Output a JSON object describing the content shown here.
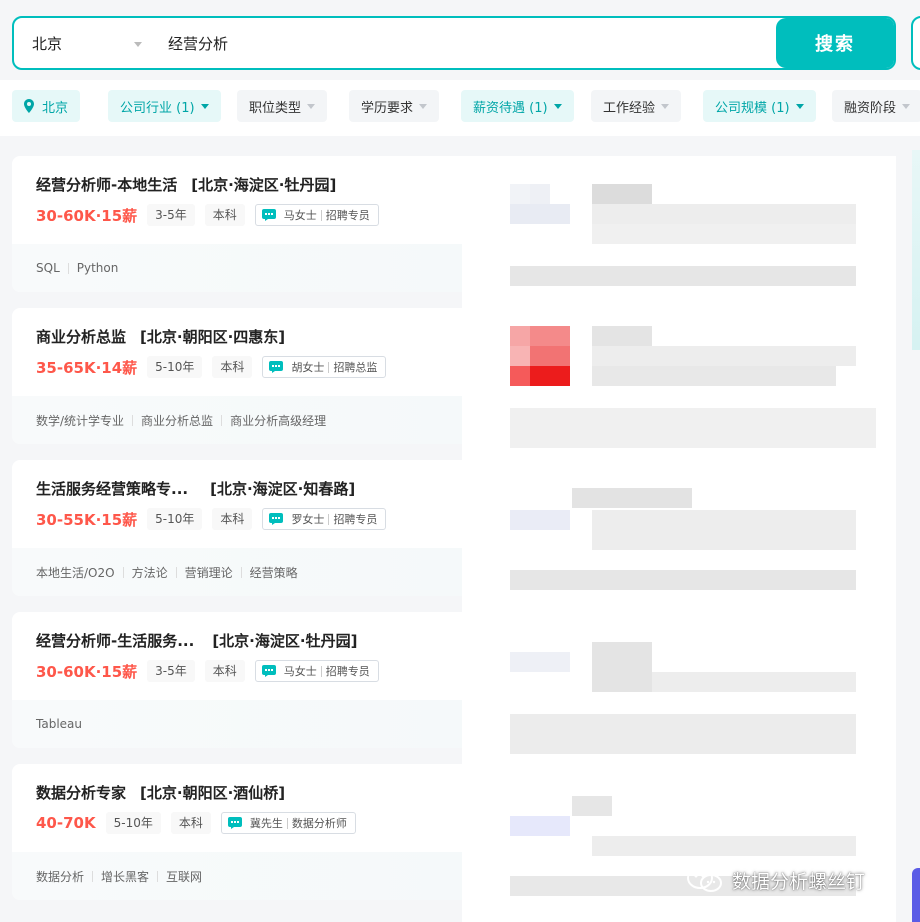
{
  "search": {
    "city": "北京",
    "query": "经营分析",
    "button_label": "搜索"
  },
  "filters": [
    {
      "label": "北京",
      "active": true,
      "icon": "location-pin-icon"
    },
    {
      "label": "公司行业 (1)",
      "active": true
    },
    {
      "label": "职位类型",
      "active": false
    },
    {
      "label": "学历要求",
      "active": false
    },
    {
      "label": "薪资待遇 (1)",
      "active": true
    },
    {
      "label": "工作经验",
      "active": false
    },
    {
      "label": "公司规模 (1)",
      "active": true
    },
    {
      "label": "融资阶段",
      "active": false
    }
  ],
  "jobs": [
    {
      "title": "经营分析师-本地生活",
      "location": "[北京·海淀区·牡丹园]",
      "salary": "30-60K·15薪",
      "experience": "3-5年",
      "education": "本科",
      "recruiter_name": "马女士",
      "recruiter_role": "招聘专员",
      "skills": [
        "SQL",
        "Python"
      ]
    },
    {
      "title": "商业分析总监",
      "location": "[北京·朝阳区·四惠东]",
      "salary": "35-65K·14薪",
      "experience": "5-10年",
      "education": "本科",
      "recruiter_name": "胡女士",
      "recruiter_role": "招聘总监",
      "skills": [
        "数学/统计学专业",
        "商业分析总监",
        "商业分析高级经理"
      ]
    },
    {
      "title": "生活服务经营策略专...",
      "location": "[北京·海淀区·知春路]",
      "salary": "30-55K·15薪",
      "experience": "5-10年",
      "education": "本科",
      "recruiter_name": "罗女士",
      "recruiter_role": "招聘专员",
      "skills": [
        "本地生活/O2O",
        "方法论",
        "营销理论",
        "经营策略"
      ]
    },
    {
      "title": "经营分析师-生活服务...",
      "location": "[北京·海淀区·牡丹园]",
      "salary": "30-60K·15薪",
      "experience": "3-5年",
      "education": "本科",
      "recruiter_name": "马女士",
      "recruiter_role": "招聘专员",
      "skills": [
        "Tableau"
      ]
    },
    {
      "title": "数据分析专家",
      "location": "[北京·朝阳区·酒仙桥]",
      "salary": "40-70K",
      "experience": "5-10年",
      "education": "本科",
      "recruiter_name": "冀先生",
      "recruiter_role": "数据分析师",
      "skills": [
        "数据分析",
        "增长黑客",
        "互联网"
      ]
    }
  ],
  "watermark": "数据分析螺丝钉",
  "colors": {
    "accent": "#00bebd",
    "salary": "#fe574a",
    "active_chip_bg": "#e6f8f8"
  }
}
